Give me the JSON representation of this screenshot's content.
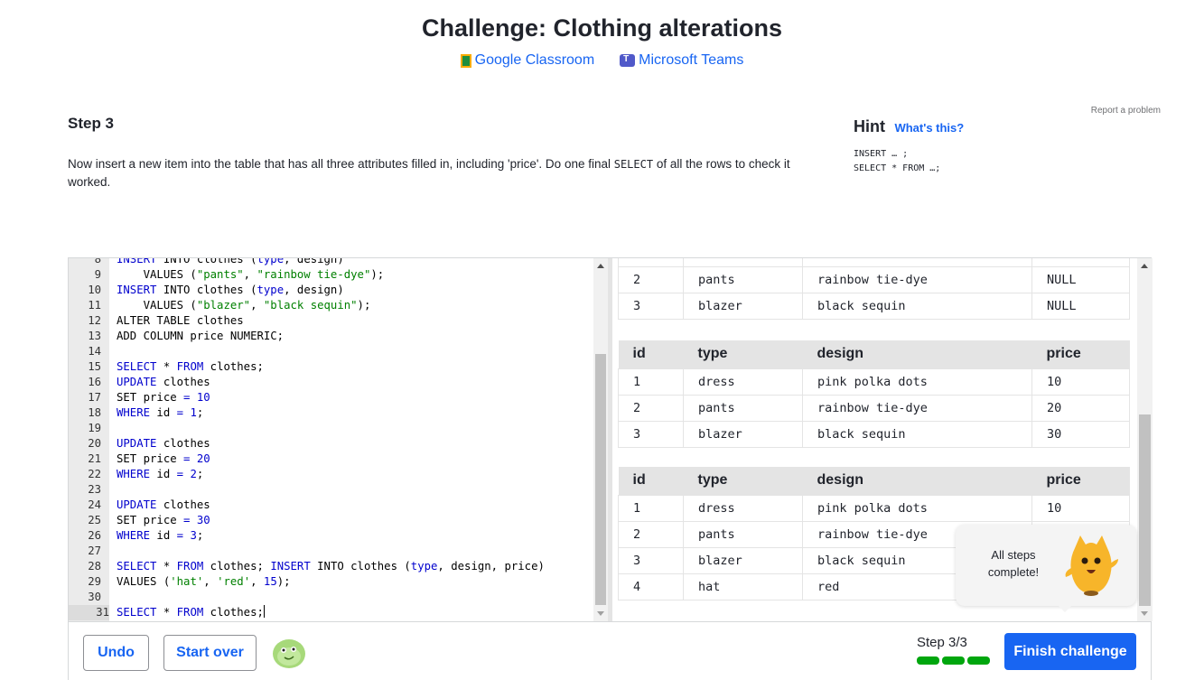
{
  "header": {
    "title": "Challenge: Clothing alterations",
    "share": {
      "classroom_label": "Google Classroom",
      "teams_label": "Microsoft Teams"
    }
  },
  "report_label": "Report a problem",
  "step": {
    "heading": "Step 3",
    "text_before": "Now insert a new item into the table that has all three attributes filled in, including 'price'. Do one final ",
    "text_code": "SELECT",
    "text_after": " of all the rows to check it worked."
  },
  "hint": {
    "title": "Hint",
    "link": "What's this?",
    "line1": "INSERT … ;",
    "line2": "SELECT * FROM …;"
  },
  "editor": {
    "lines": [
      {
        "n": "8",
        "text": "INSERT INTO clothes (type, design)"
      },
      {
        "n": "9",
        "text": "    VALUES (\"pants\", \"rainbow tie-dye\");"
      },
      {
        "n": "10",
        "text": "INSERT INTO clothes (type, design)"
      },
      {
        "n": "11",
        "text": "    VALUES (\"blazer\", \"black sequin\");"
      },
      {
        "n": "12",
        "text": "ALTER TABLE clothes"
      },
      {
        "n": "13",
        "text": "ADD COLUMN price NUMERIC;"
      },
      {
        "n": "14",
        "text": ""
      },
      {
        "n": "15",
        "text": "SELECT * FROM clothes;"
      },
      {
        "n": "16",
        "text": "UPDATE clothes"
      },
      {
        "n": "17",
        "text": "SET price = 10"
      },
      {
        "n": "18",
        "text": "WHERE id = 1;"
      },
      {
        "n": "19",
        "text": ""
      },
      {
        "n": "20",
        "text": "UPDATE clothes"
      },
      {
        "n": "21",
        "text": "SET price = 20"
      },
      {
        "n": "22",
        "text": "WHERE id = 2;"
      },
      {
        "n": "23",
        "text": ""
      },
      {
        "n": "24",
        "text": "UPDATE clothes"
      },
      {
        "n": "25",
        "text": "SET price = 30"
      },
      {
        "n": "26",
        "text": "WHERE id = 3;"
      },
      {
        "n": "27",
        "text": ""
      },
      {
        "n": "28",
        "text": "SELECT * FROM clothes; INSERT INTO clothes (type, design, price)"
      },
      {
        "n": "29",
        "text": "VALUES ('hat', 'red', 15);"
      },
      {
        "n": "30",
        "text": ""
      },
      {
        "n": "31",
        "text": "SELECT * FROM clothes;"
      }
    ]
  },
  "results": {
    "table1_rows": [
      [
        "2",
        "pants",
        "rainbow tie-dye",
        "NULL"
      ],
      [
        "3",
        "blazer",
        "black sequin",
        "NULL"
      ]
    ],
    "table2": {
      "headers": [
        "id",
        "type",
        "design",
        "price"
      ],
      "rows": [
        [
          "1",
          "dress",
          "pink polka dots",
          "10"
        ],
        [
          "2",
          "pants",
          "rainbow tie-dye",
          "20"
        ],
        [
          "3",
          "blazer",
          "black sequin",
          "30"
        ]
      ]
    },
    "table3": {
      "headers": [
        "id",
        "type",
        "design",
        "price"
      ],
      "rows": [
        [
          "1",
          "dress",
          "pink polka dots",
          "10"
        ],
        [
          "2",
          "pants",
          "rainbow tie-dye",
          ""
        ],
        [
          "3",
          "blazer",
          "black sequin",
          ""
        ],
        [
          "4",
          "hat",
          "red",
          ""
        ]
      ]
    }
  },
  "toast": {
    "line1": "All steps",
    "line2": "complete!"
  },
  "footer": {
    "undo_label": "Undo",
    "start_over_label": "Start over",
    "step_label": "Step 3/3",
    "progress_current": 3,
    "progress_total": 3,
    "finish_label": "Finish challenge"
  },
  "colors": {
    "accent": "#1865f2",
    "progress": "#00a60e"
  }
}
